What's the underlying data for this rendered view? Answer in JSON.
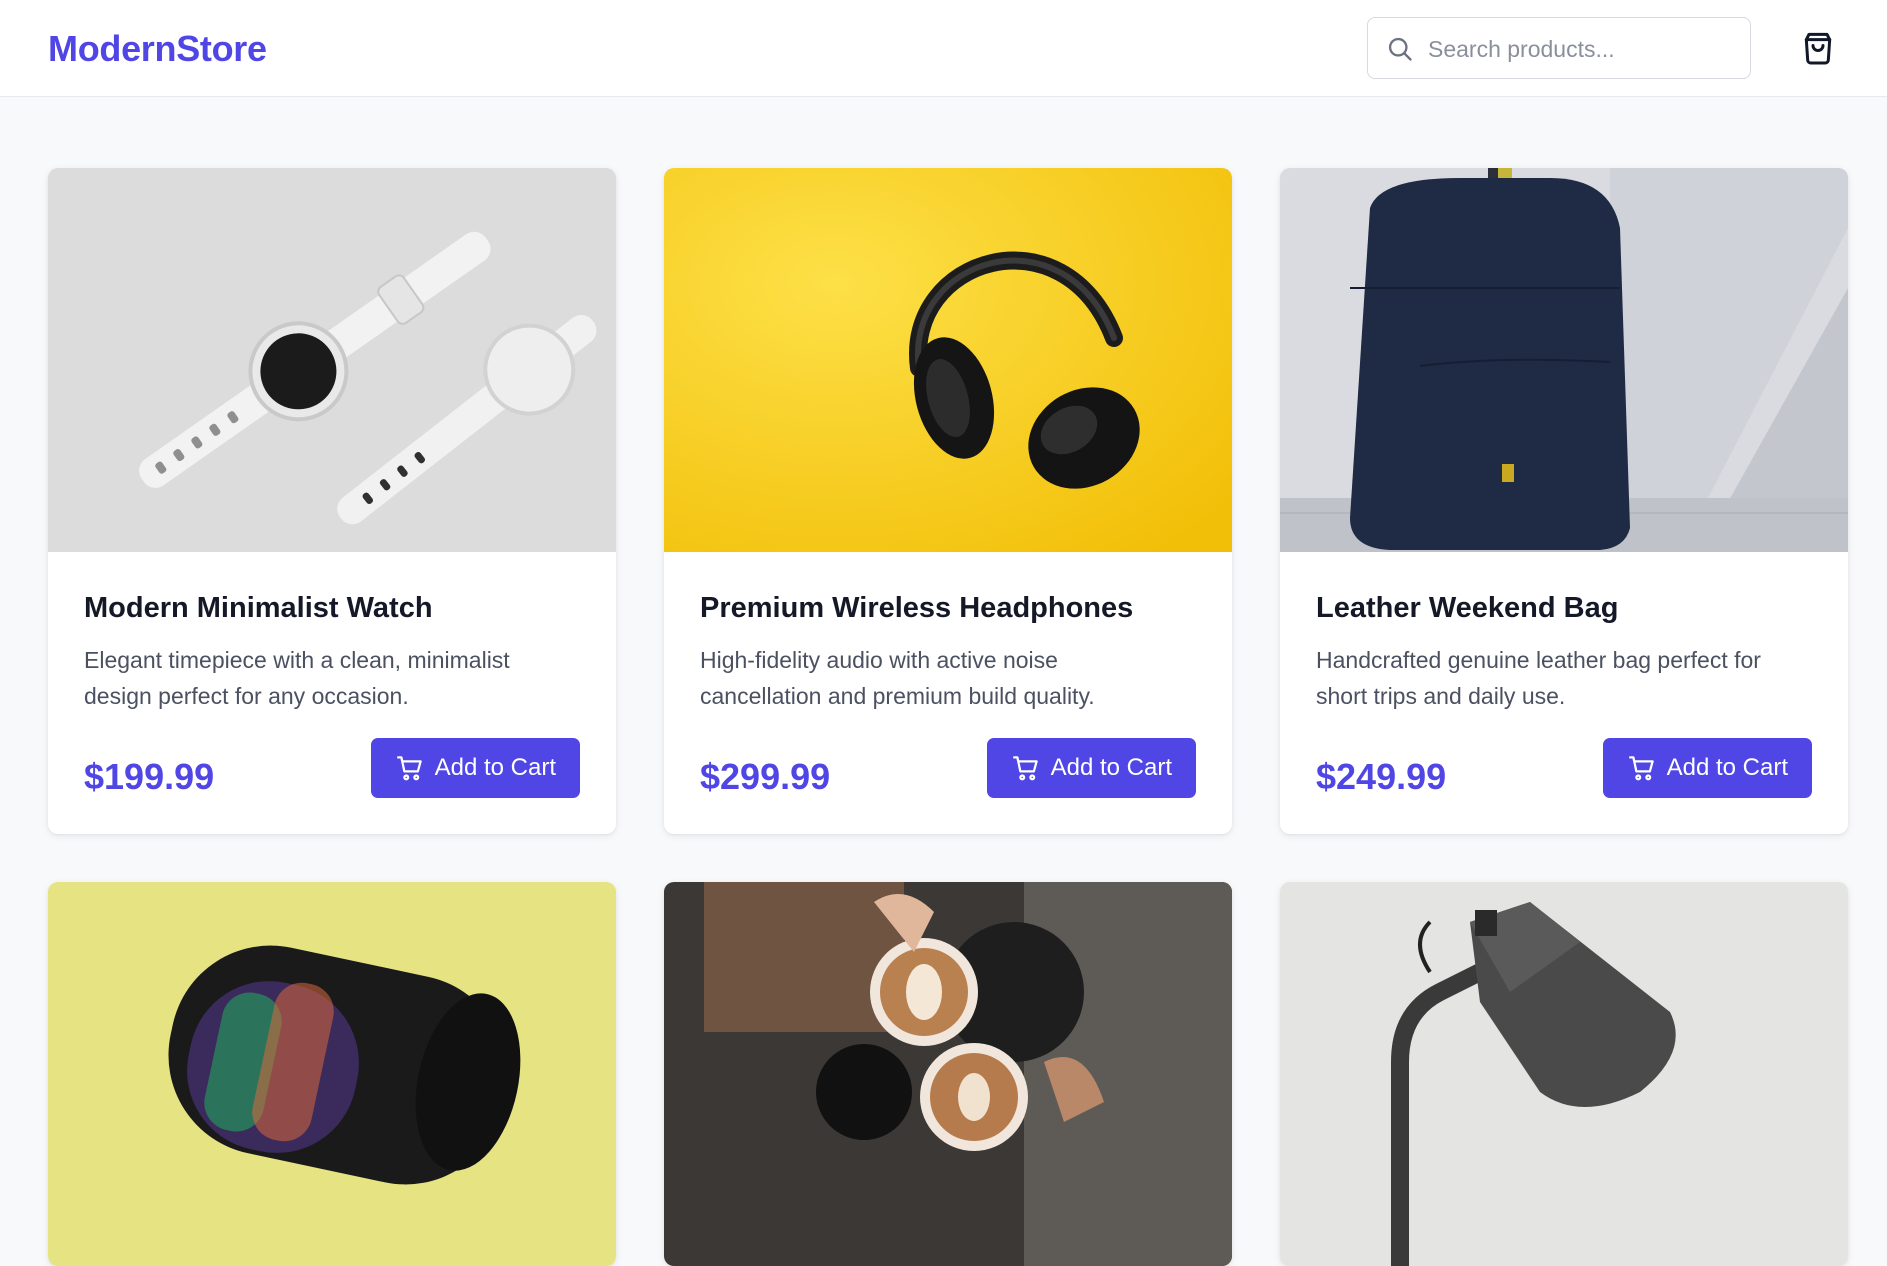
{
  "brand": {
    "name": "ModernStore",
    "accent": "#4f46e5"
  },
  "search": {
    "placeholder": "Search products...",
    "value": ""
  },
  "header_icons": {
    "search": "search-icon",
    "cart": "shopping-bag-icon"
  },
  "products": [
    {
      "title": "Modern Minimalist Watch",
      "description": "Elegant timepiece with a clean, minimalist design perfect for any occasion.",
      "price": "$199.99",
      "button": "Add to Cart"
    },
    {
      "title": "Premium Wireless Headphones",
      "description": "High-fidelity audio with active noise cancellation and premium build quality.",
      "price": "$299.99",
      "button": "Add to Cart"
    },
    {
      "title": "Leather Weekend Bag",
      "description": "Handcrafted genuine leather bag perfect for short trips and daily use.",
      "price": "$249.99",
      "button": "Add to Cart"
    },
    {
      "title": "",
      "description": "",
      "price": "",
      "button": ""
    },
    {
      "title": "",
      "description": "",
      "price": "",
      "button": ""
    },
    {
      "title": "",
      "description": "",
      "price": "",
      "button": ""
    }
  ]
}
